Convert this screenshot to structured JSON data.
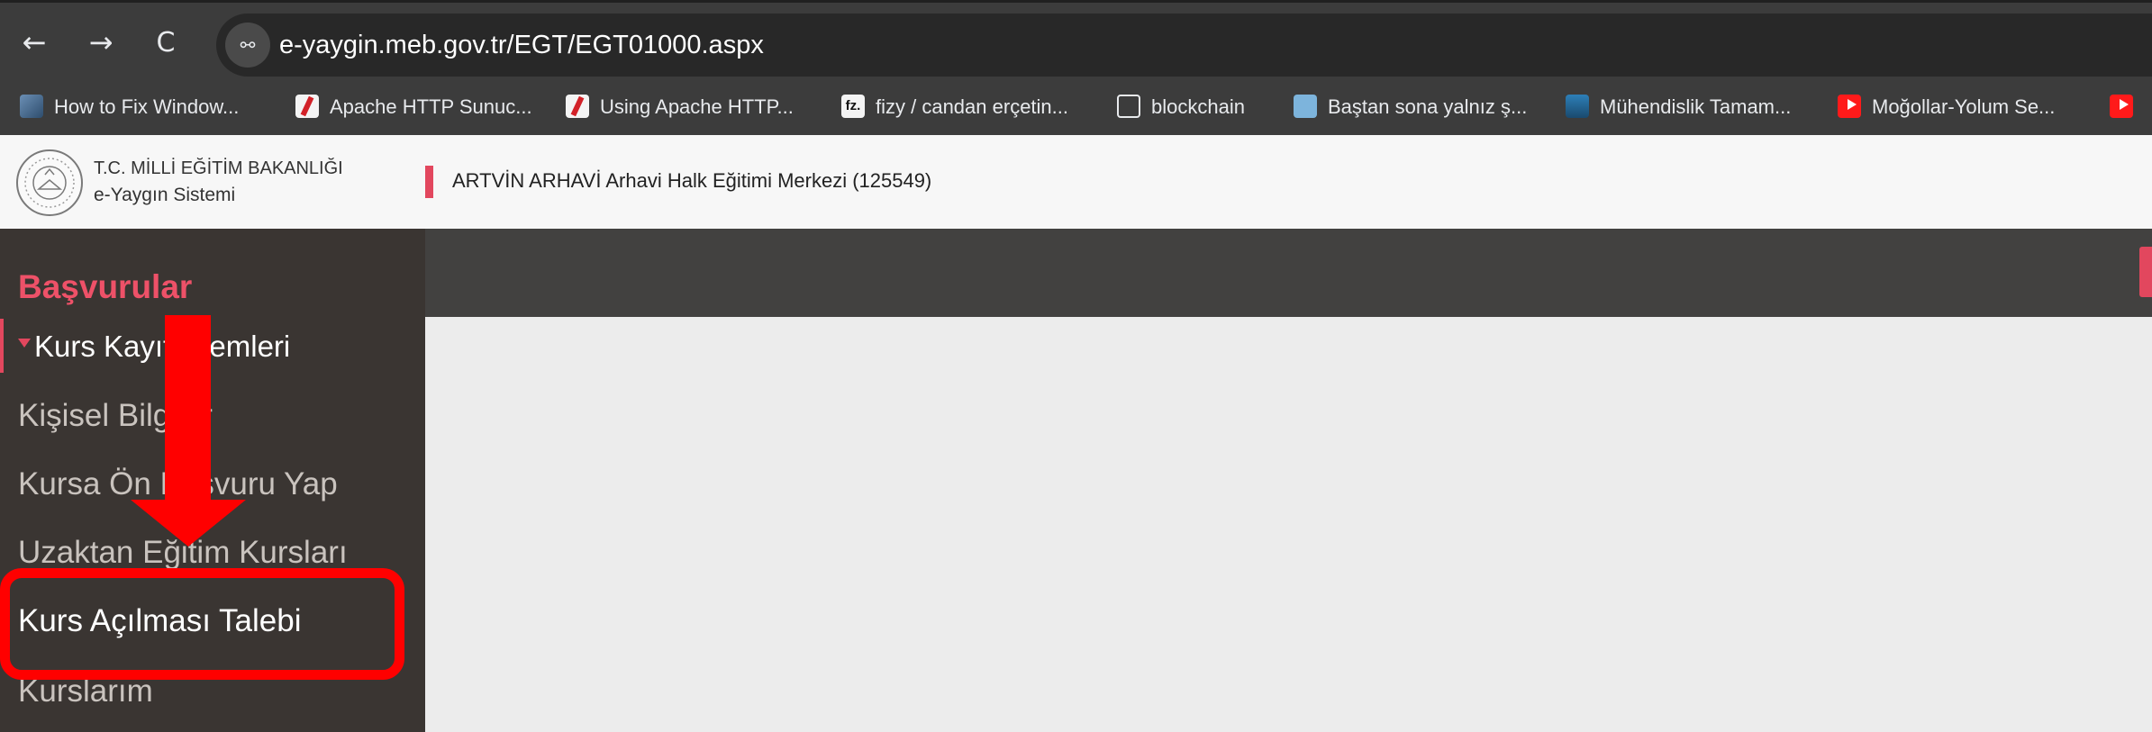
{
  "browser": {
    "back_glyph": "←",
    "forward_glyph": "→",
    "reload_glyph": "C",
    "site_info_glyph": "⚯",
    "url": "e-yaygin.meb.gov.tr/EGT/EGT01000.aspx"
  },
  "bookmarks": [
    {
      "label": "How to Fix Window...",
      "icon": "windows-help-favicon"
    },
    {
      "label": "Apache HTTP Sunuc...",
      "icon": "apache-feather-icon"
    },
    {
      "label": "Using Apache HTTP...",
      "icon": "apache-feather-icon"
    },
    {
      "label": "fizy / candan erçetin...",
      "icon": "fizy-icon",
      "icon_text": "fz."
    },
    {
      "label": "blockchain",
      "icon": "folder-icon"
    },
    {
      "label": "Baştan sona yalnız ş...",
      "icon": "owl-icon"
    },
    {
      "label": "Mühendislik Tamam...",
      "icon": "leaf-icon"
    },
    {
      "label": "Moğollar-Yolum Se...",
      "icon": "youtube-icon"
    },
    {
      "label": "",
      "icon": "youtube-icon"
    }
  ],
  "header": {
    "org_name": "T.C. MİLLİ EĞİTİM BAKANLIĞI",
    "system_name": "e-Yaygın Sistemi",
    "institution": "ARTVİN ARHAVİ Arhavi Halk Eğitimi Merkezi (125549)"
  },
  "sidebar": {
    "title": "Başvurular",
    "group_label": "Kurs Kayıt İşlemleri",
    "items": [
      {
        "label": "Kişisel Bilgiler"
      },
      {
        "label": "Kursa Ön Başvuru Yap"
      },
      {
        "label": "Uzaktan Eğitim Kursları"
      },
      {
        "label": "Kurs Açılması Talebi",
        "active": true
      },
      {
        "label": "Kurslarım"
      }
    ]
  },
  "colors": {
    "accent": "#e2475e",
    "sidebar_bg": "#3a3532",
    "toolbar_bg": "#424140",
    "annotation": "#ff0000"
  }
}
